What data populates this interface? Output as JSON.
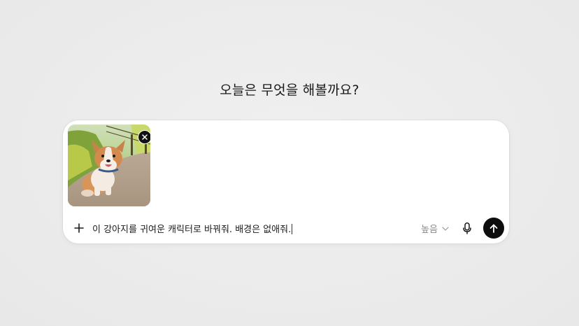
{
  "heading": "오늘은 무엇을 해볼까요?",
  "attachment": {
    "kind": "image",
    "subject": "corgi puppy photo",
    "remove_icon": "close-icon"
  },
  "composer": {
    "add_icon": "plus-icon",
    "prompt_value": "이 강아지를 귀여운 캐릭터로 바꿔줘. 배경은 없애줘.",
    "quality_label": "높음",
    "quality_icon": "chevron-down-icon",
    "mic_icon": "microphone-icon",
    "send_icon": "arrow-up-icon"
  },
  "colors": {
    "background": "#ececec",
    "panel": "#ffffff",
    "send_button": "#0d0d0d",
    "muted_text": "#8a8a8a"
  }
}
